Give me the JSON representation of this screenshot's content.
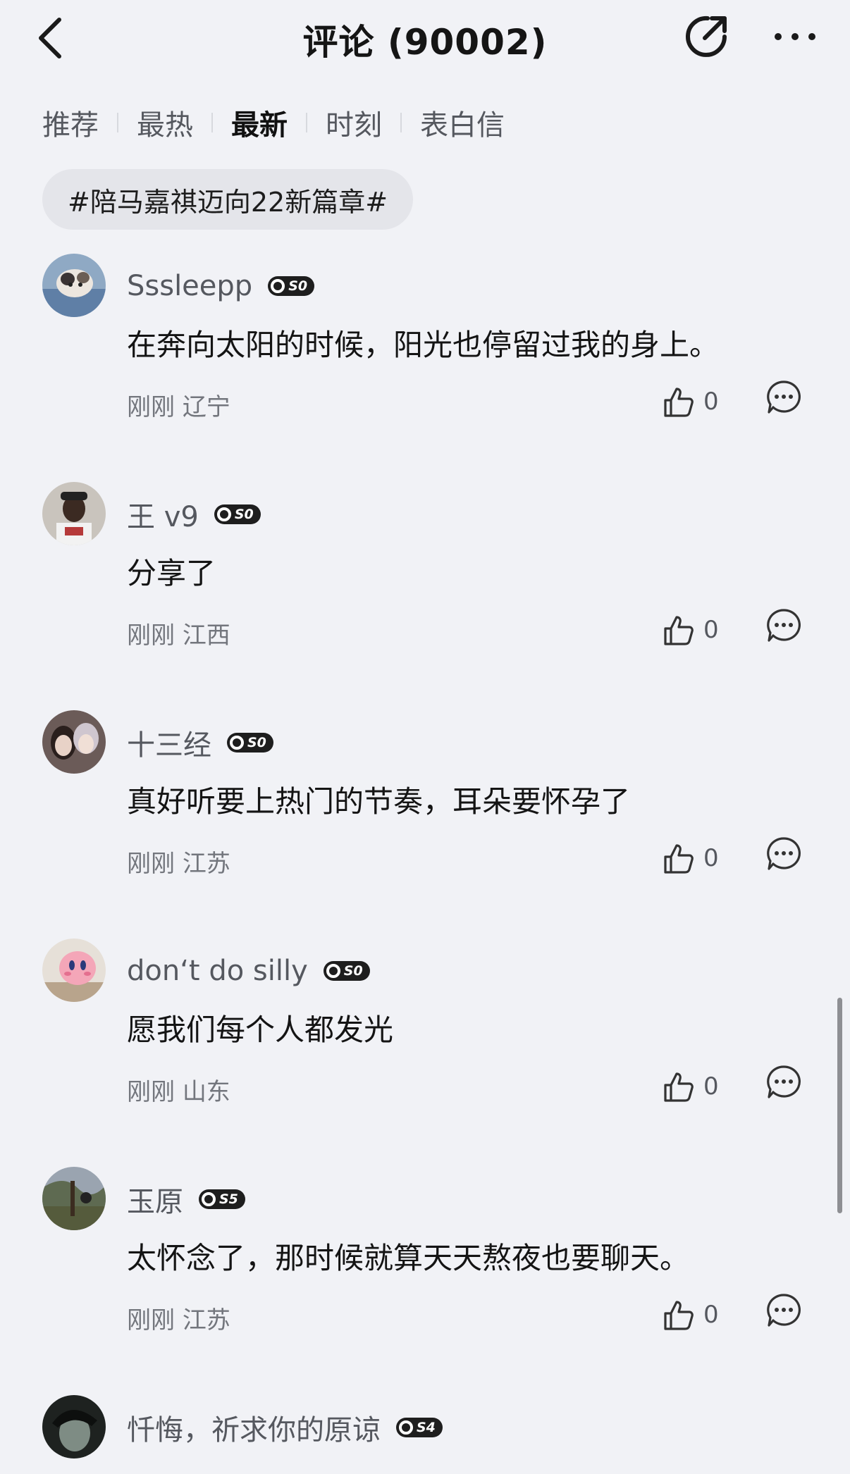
{
  "header": {
    "title": "评论 (90002)",
    "back_icon": "chevron-left-icon",
    "share_icon": "share-icon",
    "more_icon": "more-dots-icon"
  },
  "tabs": [
    {
      "label": "推荐",
      "active": false
    },
    {
      "label": "最热",
      "active": false
    },
    {
      "label": "最新",
      "active": true
    },
    {
      "label": "时刻",
      "active": false
    },
    {
      "label": "表白信",
      "active": false
    }
  ],
  "topic": "#陪马嘉祺迈向22新篇章#",
  "comments": [
    {
      "username": "Sssleepp",
      "level": "S0",
      "content": "在奔向太阳的时候，阳光也停留过我的身上。",
      "time": "刚刚",
      "location": "辽宁",
      "likes": "0"
    },
    {
      "username": "王 v9",
      "level": "S0",
      "content": "分享了",
      "time": "刚刚",
      "location": "江西",
      "likes": "0"
    },
    {
      "username": "十三经",
      "level": "S0",
      "content": "真好听要上热门的节奏，耳朵要怀孕了",
      "time": "刚刚",
      "location": "江苏",
      "likes": "0"
    },
    {
      "username": "don‘t do silly",
      "level": "S0",
      "content": "愿我们每个人都发光",
      "time": "刚刚",
      "location": "山东",
      "likes": "0"
    },
    {
      "username": "玉原",
      "level": "S5",
      "content": "太怀念了，那时候就算天天熬夜也要聊天。",
      "time": "刚刚",
      "location": "江苏",
      "likes": "0"
    },
    {
      "username": "忏悔，祈求你的原谅",
      "level": "S4",
      "content": "",
      "time": "",
      "location": "",
      "likes": ""
    }
  ],
  "colors": {
    "background": "#f1f2f6",
    "badge": "#1e1e1e",
    "muted_text": "#73767d",
    "pill": "#e4e5ea"
  }
}
